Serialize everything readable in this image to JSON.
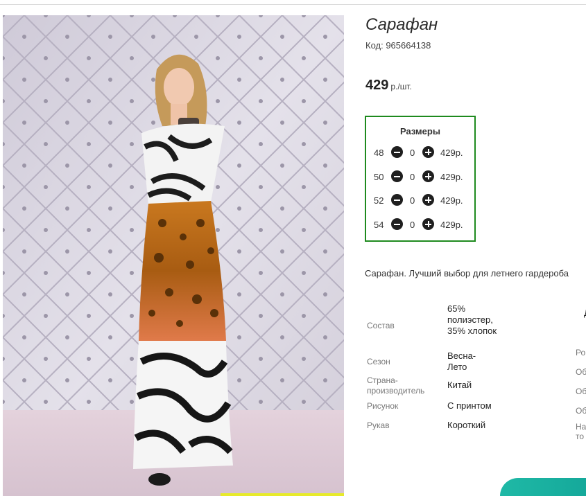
{
  "product": {
    "title": "Сарафан",
    "code": "Код: 965664138",
    "price": "429",
    "price_unit": "р./шт.",
    "description": "Сарафан. Лучший выбор для летнего гардероба"
  },
  "sizes": {
    "header": "Размеры",
    "rows": [
      {
        "size": "48",
        "qty": "0",
        "price": "429р."
      },
      {
        "size": "50",
        "qty": "0",
        "price": "429р."
      },
      {
        "size": "52",
        "qty": "0",
        "price": "429р."
      },
      {
        "size": "54",
        "qty": "0",
        "price": "429р."
      }
    ]
  },
  "specs": [
    {
      "label": "Состав",
      "value": "65% полиэстер, 35% хлопок"
    },
    {
      "label": "Сезон",
      "value": "Весна-Лето"
    },
    {
      "label": "Страна-производитель",
      "value": "Китай"
    },
    {
      "label": "Рисунок",
      "value": "С принтом"
    },
    {
      "label": "Рукав",
      "value": "Короткий"
    }
  ],
  "cut_off_column": {
    "heading": "Д",
    "labels": [
      "Ро",
      "Об",
      "Об",
      "Об",
      "На",
      "то"
    ]
  },
  "colors": {
    "sizes_border": "#1e8a1e",
    "action_button": "#1fb9a6"
  }
}
